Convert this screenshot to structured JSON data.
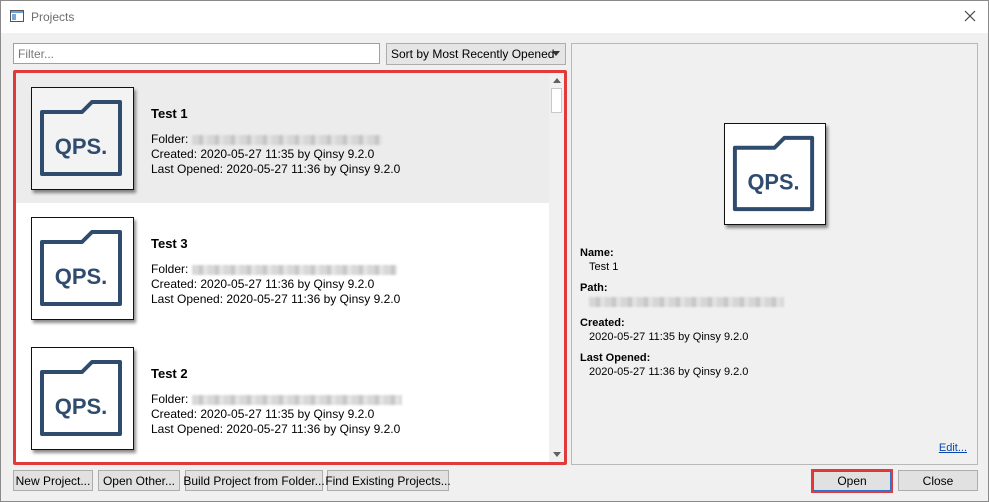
{
  "window": {
    "title": "Projects"
  },
  "toolbar": {
    "filter_placeholder": "Filter...",
    "sort_selected": "Sort by Most Recently Opened"
  },
  "projects": [
    {
      "name": "Test 1",
      "folder_label": "Folder:",
      "created": "Created: 2020-05-27 11:35 by Qinsy 9.2.0",
      "last_opened": "Last Opened: 2020-05-27 11:36 by Qinsy 9.2.0",
      "logo_text": "QPS."
    },
    {
      "name": "Test 3",
      "folder_label": "Folder:",
      "created": "Created: 2020-05-27 11:36 by Qinsy 9.2.0",
      "last_opened": "Last Opened: 2020-05-27 11:36 by Qinsy 9.2.0",
      "logo_text": "QPS."
    },
    {
      "name": "Test 2",
      "folder_label": "Folder:",
      "created": "Created: 2020-05-27 11:35 by Qinsy 9.2.0",
      "last_opened": "Last Opened: 2020-05-27 11:36 by Qinsy 9.2.0",
      "logo_text": "QPS."
    }
  ],
  "details": {
    "logo_text": "QPS.",
    "name_label": "Name:",
    "name_value": "Test 1",
    "path_label": "Path:",
    "created_label": "Created:",
    "created_value": "2020-05-27 11:35 by Qinsy 9.2.0",
    "last_opened_label": "Last Opened:",
    "last_opened_value": "2020-05-27 11:36 by Qinsy 9.2.0",
    "edit_link": "Edit..."
  },
  "buttons": {
    "new_project": "New Project...",
    "open_other": "Open Other...",
    "build_from_folder": "Build Project from Folder...",
    "find_existing": "Find Existing Projects...",
    "open": "Open",
    "close": "Close"
  },
  "colors": {
    "highlight_red": "#e03a3a",
    "logo_blue": "#2f4c6e",
    "link_blue": "#0645ad"
  }
}
